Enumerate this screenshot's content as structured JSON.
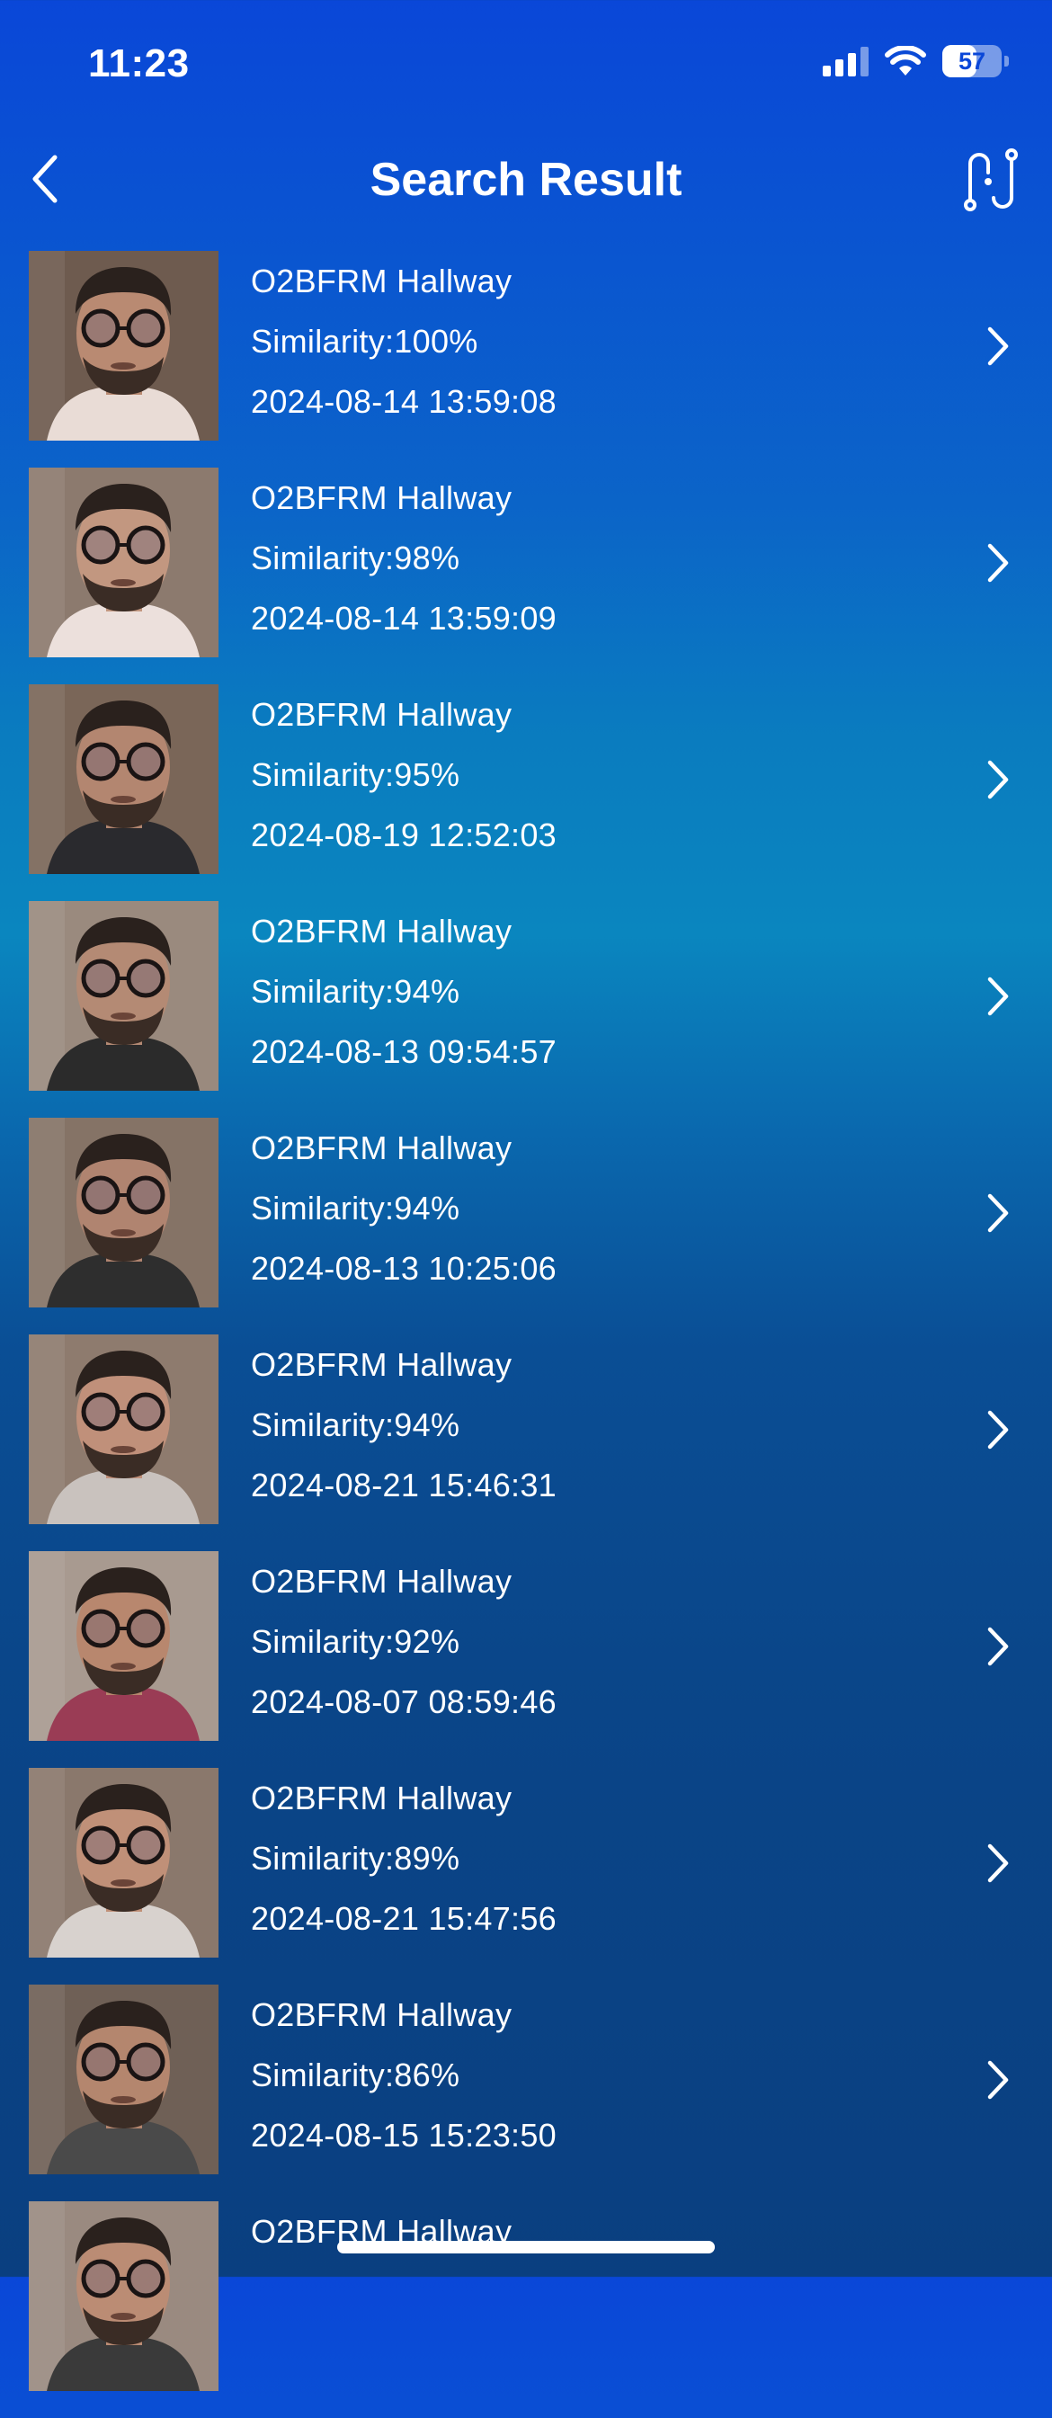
{
  "status_bar": {
    "time": "11:23",
    "battery_level": "57",
    "battery_fraction": 0.57,
    "icons": [
      "cellular-signal-icon",
      "wifi-icon",
      "battery-icon"
    ]
  },
  "header": {
    "title": "Search Result",
    "back_icon": "chevron-left-icon",
    "action_icon": "route-icon"
  },
  "colors": {
    "background_top": "#0a47d8",
    "background_mid": "#0a86bf",
    "background_bottom": "#0a3f80",
    "text": "#ffffff"
  },
  "results": [
    {
      "camera": "O2BFRM Hallway",
      "similarity": "Similarity:100%",
      "timestamp": "2024-08-14 13:59:08",
      "skin": "#b98a72",
      "shirt": "#e9dcd6",
      "bg": "#6e5b4f"
    },
    {
      "camera": "O2BFRM Hallway",
      "similarity": "Similarity:98%",
      "timestamp": "2024-08-14 13:59:09",
      "skin": "#c29780",
      "shirt": "#ece0dc",
      "bg": "#8c7a6e"
    },
    {
      "camera": "O2BFRM Hallway",
      "similarity": "Similarity:95%",
      "timestamp": "2024-08-19 12:52:03",
      "skin": "#b38670",
      "shirt": "#2a2a2e",
      "bg": "#7a6658"
    },
    {
      "camera": "O2BFRM Hallway",
      "similarity": "Similarity:94%",
      "timestamp": "2024-08-13 09:54:57",
      "skin": "#b48a74",
      "shirt": "#2b2b2b",
      "bg": "#9a8a7e"
    },
    {
      "camera": "O2BFRM Hallway",
      "similarity": "Similarity:94%",
      "timestamp": "2024-08-13 10:25:06",
      "skin": "#b08470",
      "shirt": "#2e2e2e",
      "bg": "#857366"
    },
    {
      "camera": "O2BFRM Hallway",
      "similarity": "Similarity:94%",
      "timestamp": "2024-08-21 15:46:31",
      "skin": "#c0907a",
      "shirt": "#c9c2be",
      "bg": "#8e7b6e"
    },
    {
      "camera": "O2BFRM Hallway",
      "similarity": "Similarity:92%",
      "timestamp": "2024-08-07 08:59:46",
      "skin": "#b8876e",
      "shirt": "#9a3c55",
      "bg": "#a89a90"
    },
    {
      "camera": "O2BFRM Hallway",
      "similarity": "Similarity:89%",
      "timestamp": "2024-08-21 15:47:56",
      "skin": "#c09078",
      "shirt": "#d8d2ce",
      "bg": "#8a786c"
    },
    {
      "camera": "O2BFRM Hallway",
      "similarity": "Similarity:86%",
      "timestamp": "2024-08-15 15:23:50",
      "skin": "#b4866e",
      "shirt": "#4a4a4a",
      "bg": "#6f6056"
    },
    {
      "camera": "O2BFRM Hallway",
      "similarity": "",
      "timestamp": "",
      "skin": "#bb8c74",
      "shirt": "#3a3a3a",
      "bg": "#9a8a80"
    }
  ]
}
